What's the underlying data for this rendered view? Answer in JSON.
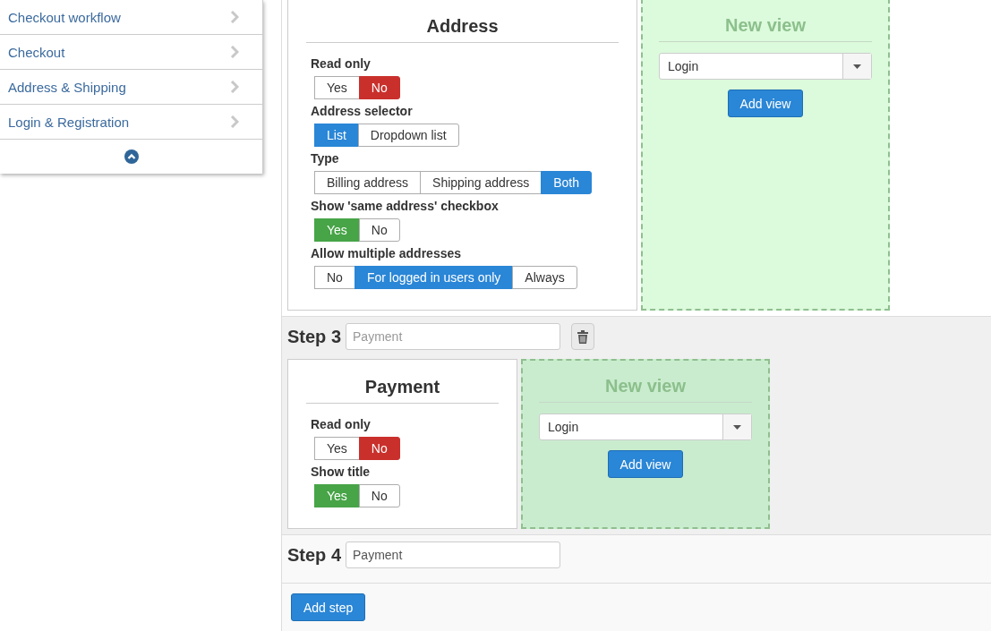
{
  "sidebar": {
    "items": [
      {
        "label": "Checkout workflow"
      },
      {
        "label": "Checkout"
      },
      {
        "label": "Address & Shipping"
      },
      {
        "label": "Login & Registration"
      }
    ]
  },
  "steps": [
    {
      "views": [
        {
          "title": "Address",
          "settings": [
            {
              "label": "Read only",
              "kind": "yesno",
              "options": [
                {
                  "label": "Yes",
                  "selected": false
                },
                {
                  "label": "No",
                  "selected": true
                }
              ]
            },
            {
              "label": "Address selector",
              "kind": "choice",
              "options": [
                {
                  "label": "List",
                  "selected": true
                },
                {
                  "label": "Dropdown list",
                  "selected": false
                }
              ]
            },
            {
              "label": "Type",
              "kind": "choice",
              "options": [
                {
                  "label": "Billing address",
                  "selected": false
                },
                {
                  "label": "Shipping address",
                  "selected": false
                },
                {
                  "label": "Both",
                  "selected": true
                }
              ]
            },
            {
              "label": "Show 'same address' checkbox",
              "kind": "yesno",
              "options": [
                {
                  "label": "Yes",
                  "selected": true
                },
                {
                  "label": "No",
                  "selected": false
                }
              ]
            },
            {
              "label": "Allow multiple addresses",
              "kind": "choice",
              "options": [
                {
                  "label": "No",
                  "selected": false
                },
                {
                  "label": "For logged in users only",
                  "selected": true
                },
                {
                  "label": "Always",
                  "selected": false
                }
              ]
            }
          ]
        }
      ],
      "new_view": {
        "title": "New view",
        "select": {
          "value": "Login"
        },
        "button": "Add view",
        "highlighted": false
      }
    },
    {
      "title": "Step 3",
      "name_field": {
        "placeholder": "Payment"
      },
      "deletable": true,
      "views": [
        {
          "title": "Payment",
          "settings": [
            {
              "label": "Read only",
              "kind": "yesno",
              "options": [
                {
                  "label": "Yes",
                  "selected": false
                },
                {
                  "label": "No",
                  "selected": true
                }
              ]
            },
            {
              "label": "Show title",
              "kind": "yesno",
              "options": [
                {
                  "label": "Yes",
                  "selected": true
                },
                {
                  "label": "No",
                  "selected": false
                }
              ]
            }
          ]
        }
      ],
      "new_view": {
        "title": "New view",
        "select": {
          "value": "Login"
        },
        "button": "Add view",
        "highlighted": true
      }
    },
    {
      "title": "Step 4",
      "name_field": {
        "value": "Payment"
      },
      "deletable": false
    }
  ],
  "add_step_button": "Add step"
}
